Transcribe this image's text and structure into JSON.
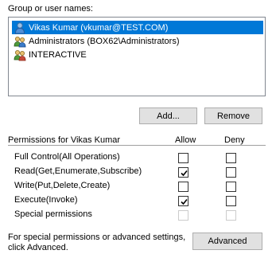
{
  "group_label": "Group or user names:",
  "users": [
    {
      "name": "Vikas Kumar (vkumar@TEST.COM)",
      "icon": "user-icon",
      "selected": true
    },
    {
      "name": "Administrators (BOX62\\Administrators)",
      "icon": "group-icon",
      "selected": false
    },
    {
      "name": "INTERACTIVE",
      "icon": "group-icon",
      "selected": false
    }
  ],
  "buttons": {
    "add": "Add...",
    "remove": "Remove",
    "advanced": "Advanced"
  },
  "permissions": {
    "header": "Permissions for Vikas Kumar",
    "allow_label": "Allow",
    "deny_label": "Deny",
    "rows": [
      {
        "name": "Full Control(All Operations)",
        "allow": false,
        "deny": false,
        "disabled": false
      },
      {
        "name": "Read(Get,Enumerate,Subscribe)",
        "allow": true,
        "deny": false,
        "disabled": false
      },
      {
        "name": "Write(Put,Delete,Create)",
        "allow": false,
        "deny": false,
        "disabled": false
      },
      {
        "name": "Execute(Invoke)",
        "allow": true,
        "deny": false,
        "disabled": false
      },
      {
        "name": "Special permissions",
        "allow": false,
        "deny": false,
        "disabled": true
      }
    ]
  },
  "advanced_note": {
    "line1": "For special permissions or advanced settings,",
    "line2": "click Advanced."
  },
  "colors": {
    "selection": "#0078d7",
    "button_face": "#e1e1e1"
  }
}
